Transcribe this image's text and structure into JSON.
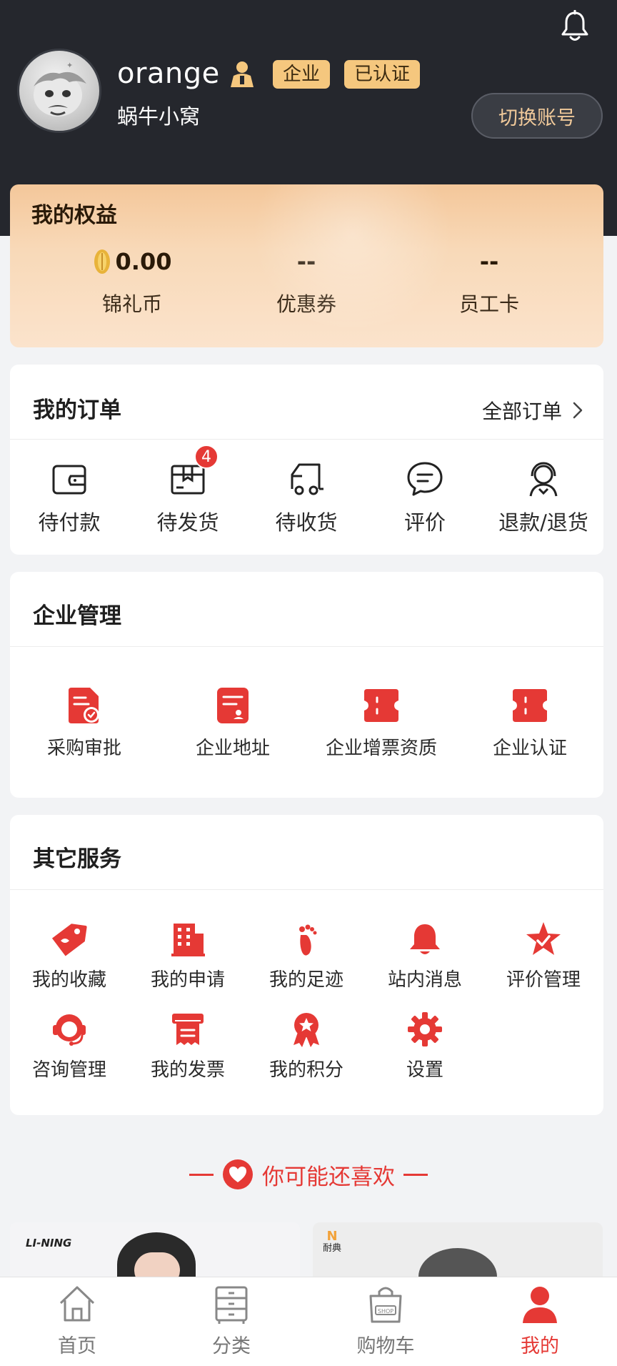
{
  "header": {
    "username": "orange",
    "tag_enterprise": "企业",
    "tag_verified": "已认证",
    "company": "蜗牛小窝",
    "switch_label": "切换账号"
  },
  "rights": {
    "title": "我的权益",
    "items": [
      {
        "value": "0.00",
        "label": "锦礼币"
      },
      {
        "value": "--",
        "label": "优惠券"
      },
      {
        "value": "--",
        "label": "员工卡"
      }
    ]
  },
  "orders": {
    "title": "我的订单",
    "all_label": "全部订单",
    "pending_ship_count": "4",
    "items": [
      {
        "label": "待付款",
        "icon": "wallet-icon"
      },
      {
        "label": "待发货",
        "icon": "package-icon"
      },
      {
        "label": "待收货",
        "icon": "truck-icon"
      },
      {
        "label": "评价",
        "icon": "comment-icon"
      },
      {
        "label": "退款/退货",
        "icon": "customer-service-icon"
      }
    ]
  },
  "enterprise": {
    "title": "企业管理",
    "items": [
      {
        "label": "采购审批",
        "icon": "approval-doc-icon"
      },
      {
        "label": "企业地址",
        "icon": "address-book-icon"
      },
      {
        "label": "企业增票资质",
        "icon": "invoice-ticket-icon"
      },
      {
        "label": "企业认证",
        "icon": "certificate-ticket-icon"
      }
    ]
  },
  "services": {
    "title": "其它服务",
    "items": [
      {
        "label": "我的收藏",
        "icon": "tag-icon"
      },
      {
        "label": "我的申请",
        "icon": "building-icon"
      },
      {
        "label": "我的足迹",
        "icon": "footprint-icon"
      },
      {
        "label": "站内消息",
        "icon": "bell-icon"
      },
      {
        "label": "评价管理",
        "icon": "star-check-icon"
      },
      {
        "label": "咨询管理",
        "icon": "headset-icon"
      },
      {
        "label": "我的发票",
        "icon": "receipt-icon"
      },
      {
        "label": "我的积分",
        "icon": "award-icon"
      },
      {
        "label": "设置",
        "icon": "gear-icon"
      }
    ]
  },
  "recommend": {
    "title": "你可能还喜欢"
  },
  "products": [
    {
      "brand": "LI-NING"
    },
    {
      "brand": "耐典"
    }
  ],
  "tabbar": {
    "items": [
      {
        "label": "首页",
        "icon": "home-icon"
      },
      {
        "label": "分类",
        "icon": "cabinet-icon"
      },
      {
        "label": "购物车",
        "icon": "shopping-bag-icon"
      },
      {
        "label": "我的",
        "icon": "user-icon"
      }
    ],
    "active": "我的"
  },
  "colors": {
    "accent": "#e53935",
    "header_bg": "#25272d",
    "tag_gold": "#f5c77e",
    "page_bg": "#f2f3f5"
  }
}
